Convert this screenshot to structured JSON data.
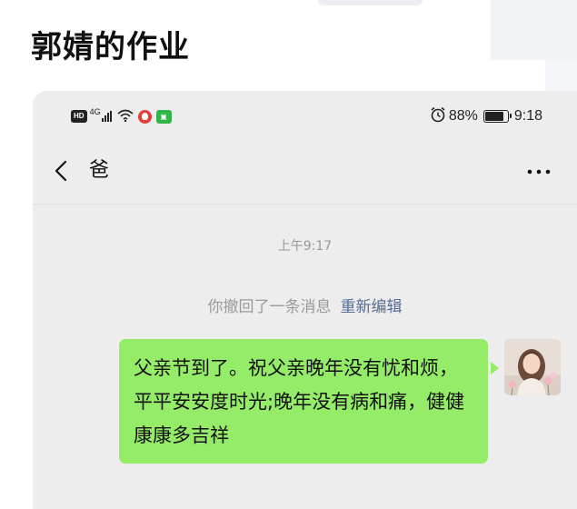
{
  "article": {
    "title": "郭婧的作业"
  },
  "status_bar": {
    "hd_label": "HD",
    "network_label": "4G",
    "battery_percent": "88%",
    "battery_level": 0.88,
    "time": "9:18"
  },
  "chat": {
    "title": "爸",
    "timestamp": "上午9:17",
    "recall_notice": "你撤回了一条消息",
    "reedit_label": "重新编辑",
    "message": "父亲节到了。祝父亲晚年没有忧和烦，平平安安度时光;晚年没有病和痛，健健康康多吉祥"
  },
  "colors": {
    "bubble": "#95ec69",
    "link": "#576b95",
    "chat_background": "#ededed"
  },
  "icons": {
    "back": "chevron-left-icon",
    "more": "more-dots-icon",
    "alarm": "alarm-icon",
    "wifi": "wifi-icon",
    "signal": "signal-icon",
    "battery": "battery-icon"
  }
}
